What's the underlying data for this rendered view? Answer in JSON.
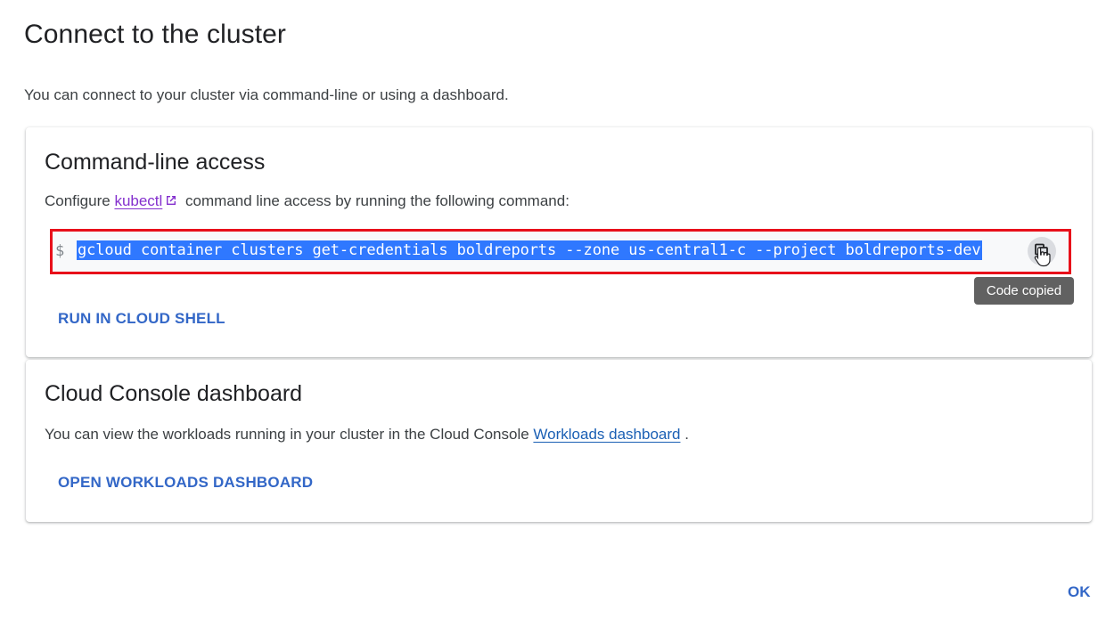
{
  "dialog": {
    "title": "Connect to the cluster",
    "subtitle": "You can connect to your cluster via command-line or using a dashboard.",
    "ok_label": "OK"
  },
  "cli": {
    "title": "Command-line access",
    "desc_before": "Configure ",
    "kubectl_link": "kubectl",
    "desc_after": " command line access by running the following command:",
    "prompt": "$",
    "command": "gcloud container clusters get-credentials boldreports --zone us-central1-c --project boldreports-dev",
    "copy_icon": "copy-icon",
    "tooltip": "Code copied",
    "run_button": "RUN IN CLOUD SHELL"
  },
  "dashboard": {
    "title": "Cloud Console dashboard",
    "desc_before": "You can view the workloads running in your cluster in the Cloud Console ",
    "workloads_link": "Workloads dashboard",
    "desc_after": " .",
    "open_button": "OPEN WORKLOADS DASHBOARD"
  },
  "colors": {
    "accent": "#3367c7",
    "highlight": "#2f78ff",
    "annotation_border": "#e8101a",
    "visited_link": "#8430ce"
  }
}
